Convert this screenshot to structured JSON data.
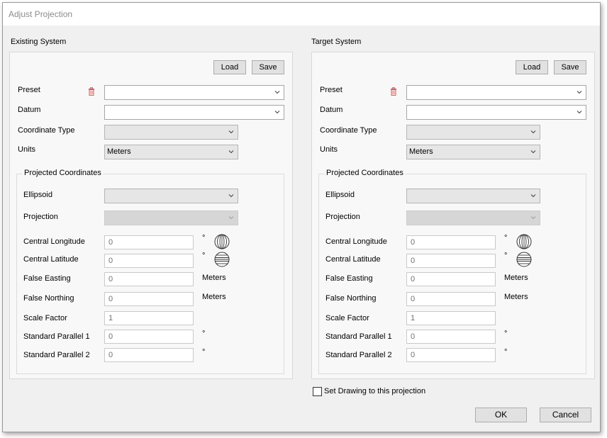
{
  "window": {
    "title": "Adjust Projection"
  },
  "systems": {
    "existing": {
      "section_label": "Existing System",
      "load_label": "Load",
      "save_label": "Save",
      "preset_label": "Preset",
      "preset_value": "",
      "datum_label": "Datum",
      "datum_value": "",
      "coord_type_label": "Coordinate Type",
      "coord_type_value": "",
      "units_label": "Units",
      "units_value": "Meters",
      "group_title": "Projected Coordinates",
      "ellipsoid_label": "Ellipsoid",
      "ellipsoid_value": "",
      "projection_label": "Projection",
      "projection_value": "",
      "central_longitude_label": "Central Longitude",
      "central_longitude_value": "0",
      "central_latitude_label": "Central Latitude",
      "central_latitude_value": "0",
      "false_easting_label": "False Easting",
      "false_easting_value": "0",
      "false_easting_unit": "Meters",
      "false_northing_label": "False Northing",
      "false_northing_value": "0",
      "false_northing_unit": "Meters",
      "scale_factor_label": "Scale Factor",
      "scale_factor_value": "1",
      "std_parallel_1_label": "Standard Parallel 1",
      "std_parallel_1_value": "0",
      "std_parallel_2_label": "Standard Parallel 2",
      "std_parallel_2_value": "0",
      "degree_symbol": "°"
    },
    "target": {
      "section_label": "Target System",
      "load_label": "Load",
      "save_label": "Save",
      "preset_label": "Preset",
      "preset_value": "",
      "datum_label": "Datum",
      "datum_value": "",
      "coord_type_label": "Coordinate Type",
      "coord_type_value": "",
      "units_label": "Units",
      "units_value": "Meters",
      "group_title": "Projected Coordinates",
      "ellipsoid_label": "Ellipsoid",
      "ellipsoid_value": "",
      "projection_label": "Projection",
      "projection_value": "",
      "central_longitude_label": "Central Longitude",
      "central_longitude_value": "0",
      "central_latitude_label": "Central Latitude",
      "central_latitude_value": "0",
      "false_easting_label": "False Easting",
      "false_easting_value": "0",
      "false_easting_unit": "Meters",
      "false_northing_label": "False Northing",
      "false_northing_value": "0",
      "false_northing_unit": "Meters",
      "scale_factor_label": "Scale Factor",
      "scale_factor_value": "1",
      "std_parallel_1_label": "Standard Parallel 1",
      "std_parallel_1_value": "0",
      "std_parallel_2_label": "Standard Parallel 2",
      "std_parallel_2_value": "0",
      "degree_symbol": "°"
    }
  },
  "footer": {
    "set_drawing_label": "Set Drawing to this projection",
    "set_drawing_checked": false,
    "ok_label": "OK",
    "cancel_label": "Cancel"
  },
  "icons": {
    "trash": "trash-icon",
    "longitude_globe": "longitude-globe-icon",
    "latitude_globe": "latitude-globe-icon",
    "chevron": "chevron-down-icon"
  },
  "colors": {
    "trash_red": "#d9534f",
    "dialog_bg": "#f0f0f0",
    "panel_bg": "#f8f8f8",
    "disabled_combo": "#d6d6d6"
  }
}
